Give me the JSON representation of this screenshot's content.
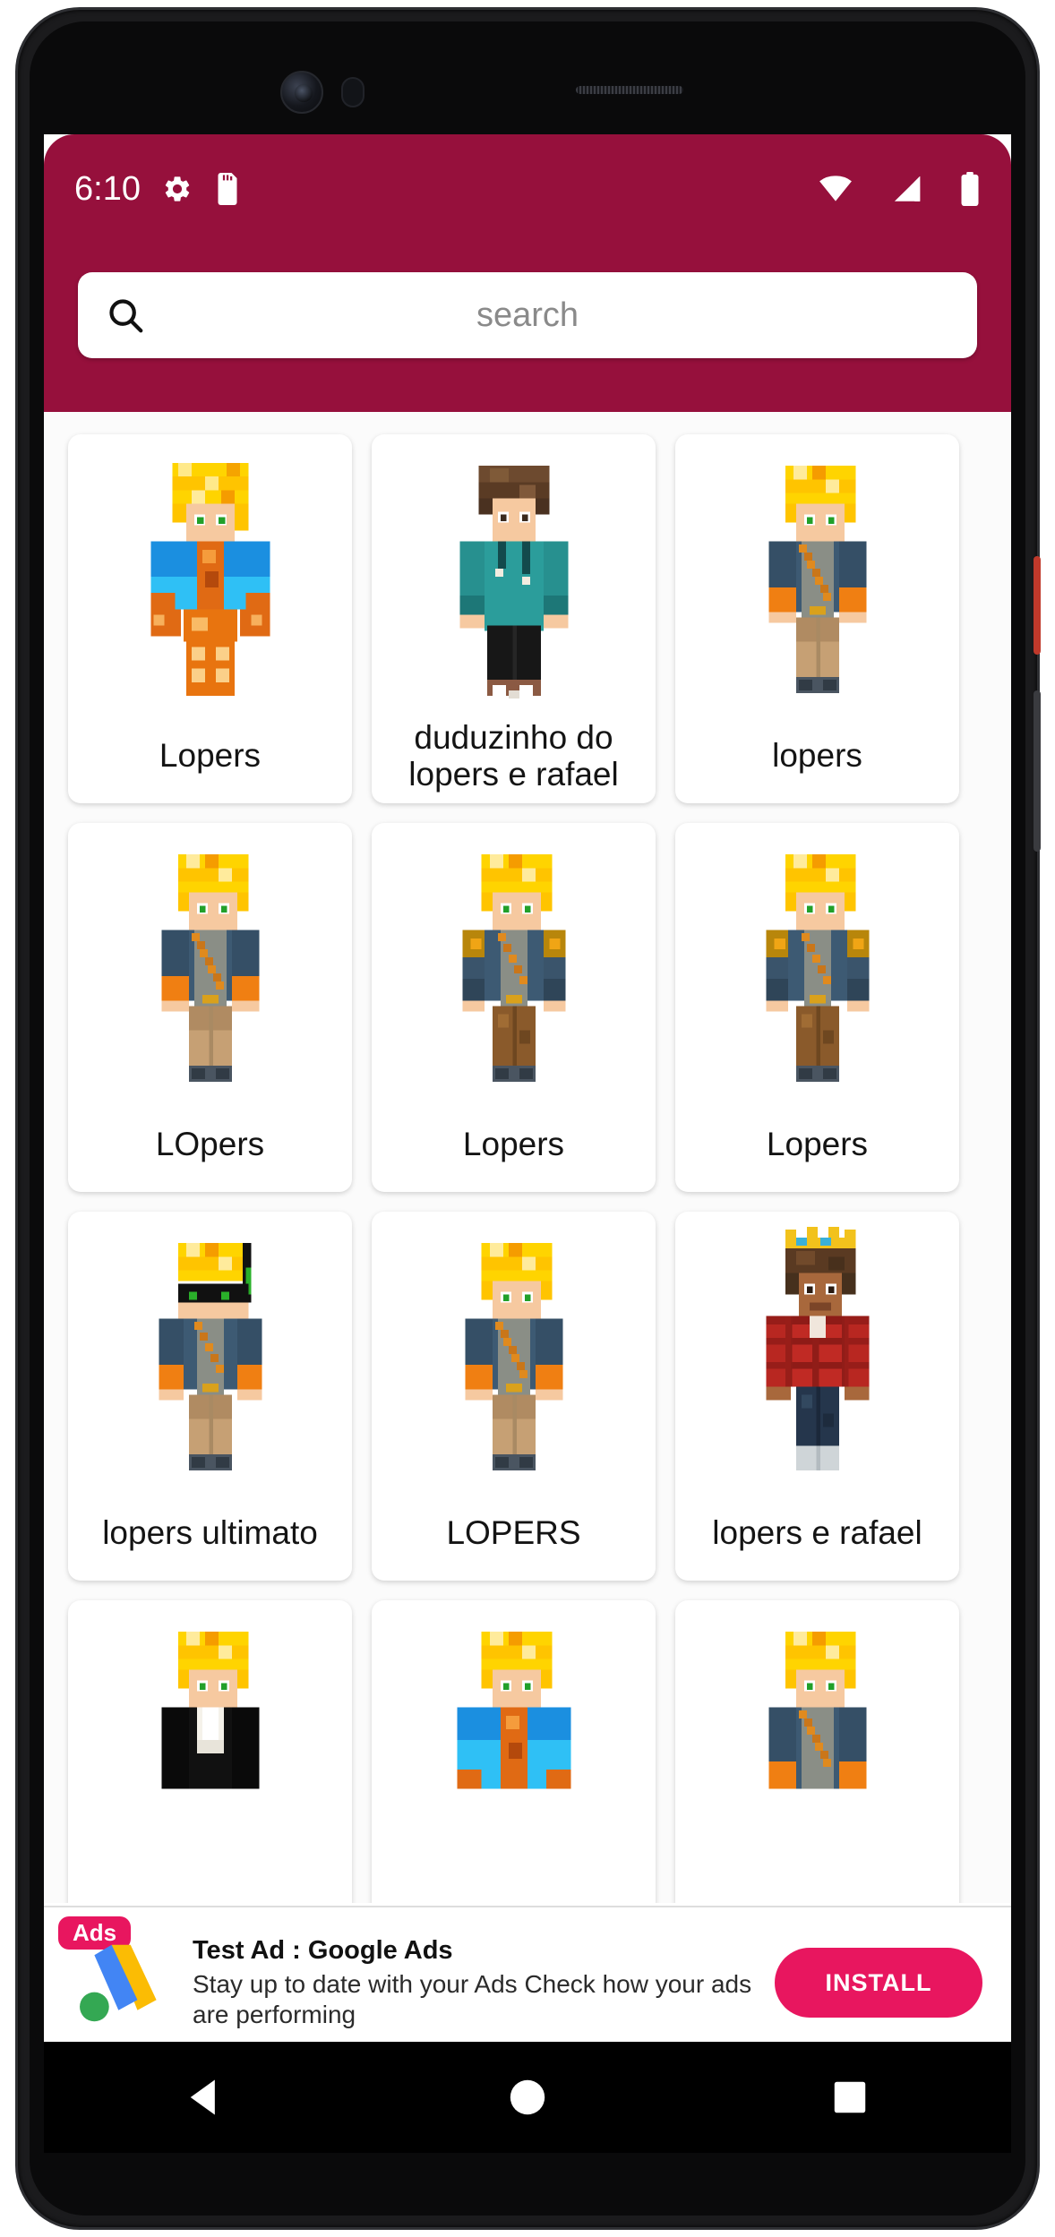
{
  "status_bar": {
    "clock": "6:10",
    "left_icons": [
      "gear-icon",
      "sd-card-icon"
    ],
    "right_icons": [
      "wifi-icon",
      "signal-icon",
      "battery-icon"
    ]
  },
  "theme": {
    "app_bar_color": "#96103C",
    "accent_color": "#E8165F",
    "grid_background": "#FBFBFB",
    "card_background": "#FFFFFF"
  },
  "search": {
    "placeholder": "search",
    "value": "",
    "icon": "search-icon"
  },
  "skins": [
    {
      "label": "Lopers",
      "art": "lava-cape"
    },
    {
      "label": "duduzinho do lopers e rafael",
      "art": "teal-hoodie"
    },
    {
      "label": "lopers",
      "art": "blue-jacket-orange"
    },
    {
      "label": "LOpers",
      "art": "blue-jacket-orange"
    },
    {
      "label": "Lopers",
      "art": "brown-pants"
    },
    {
      "label": "Lopers",
      "art": "brown-pants"
    },
    {
      "label": "lopers ultimato",
      "art": "sunglasses"
    },
    {
      "label": "LOPERS",
      "art": "blue-jacket-orange"
    },
    {
      "label": "lopers e rafael",
      "art": "crown-red-shirt"
    },
    {
      "label": "",
      "art": "black-suit"
    },
    {
      "label": "",
      "art": "lava-cape"
    },
    {
      "label": "",
      "art": "blue-jacket-orange"
    }
  ],
  "ad": {
    "badge": "Ads",
    "title": "Test Ad : Google Ads",
    "body": "Stay up to date with your Ads Check how your ads are performing",
    "install_label": "INSTALL",
    "logo": "google-ads-logo"
  },
  "nav_bar": {
    "back": "back-triangle-icon",
    "home": "home-circle-icon",
    "recents": "recents-square-icon"
  }
}
